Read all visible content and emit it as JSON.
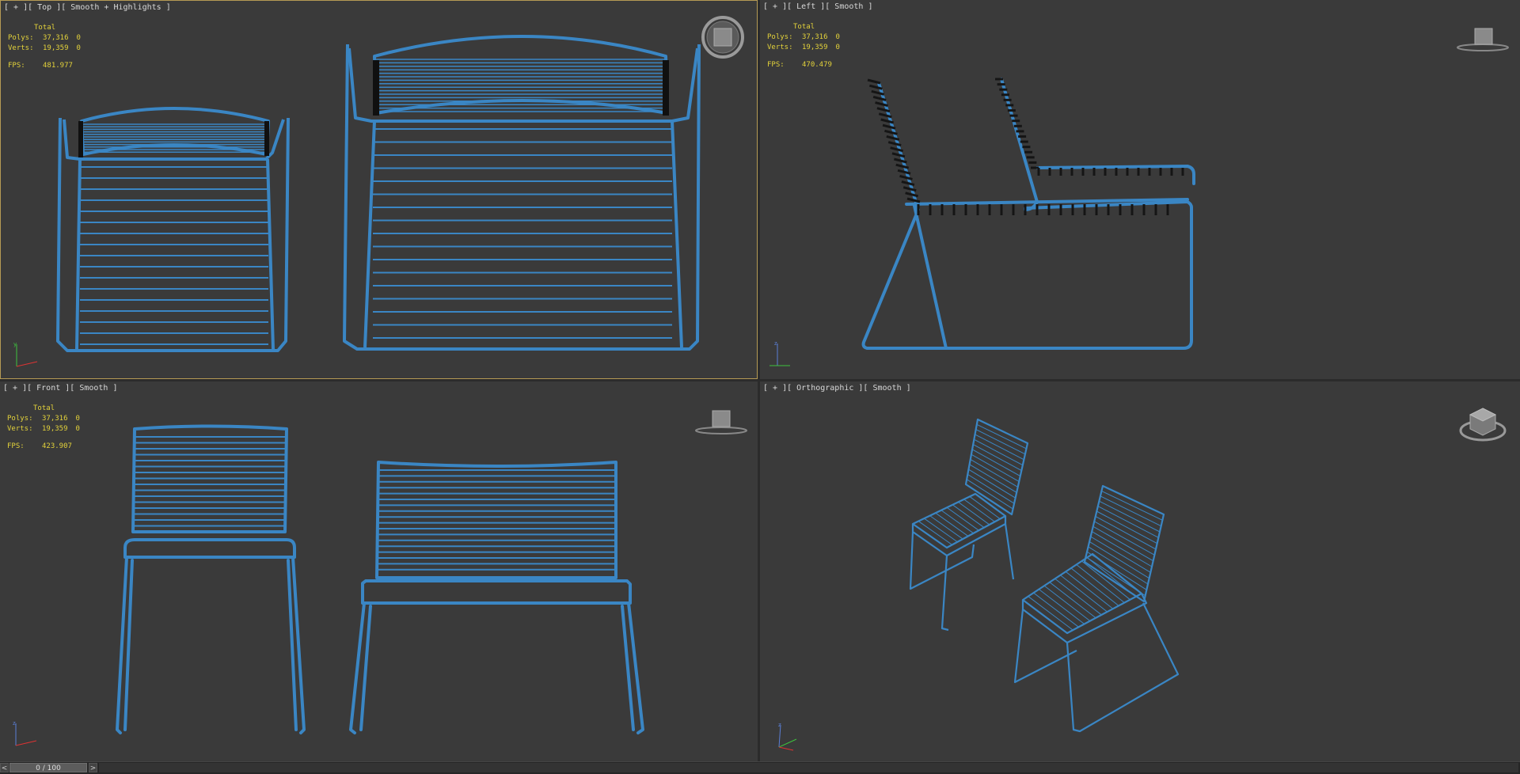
{
  "viewports": {
    "top": {
      "label": "[ + ][ Top ][ Smooth + Highlights ]",
      "stats": {
        "total": "Total",
        "polys_label": "Polys:",
        "polys": "37,316",
        "polys_sel": "0",
        "verts_label": "Verts:",
        "verts": "19,359",
        "verts_sel": "0",
        "fps_label": "FPS:",
        "fps": "481.977"
      },
      "viewcube_icon": "viewcube-top-icon"
    },
    "left": {
      "label": "[ + ][ Left ][ Smooth ]",
      "stats": {
        "total": "Total",
        "polys_label": "Polys:",
        "polys": "37,316",
        "polys_sel": "0",
        "verts_label": "Verts:",
        "verts": "19,359",
        "verts_sel": "0",
        "fps_label": "FPS:",
        "fps": "470.479"
      },
      "viewcube_icon": "viewcube-left-icon"
    },
    "front": {
      "label": "[ + ][ Front ][ Smooth ]",
      "stats": {
        "total": "Total",
        "polys_label": "Polys:",
        "polys": "37,316",
        "polys_sel": "0",
        "verts_label": "Verts:",
        "verts": "19,359",
        "verts_sel": "0",
        "fps_label": "FPS:",
        "fps": "423.907"
      },
      "viewcube_icon": "viewcube-front-icon"
    },
    "ortho": {
      "label": "[ + ][ Orthographic ][ Smooth ]",
      "viewcube_icon": "viewcube-perspective-icon"
    }
  },
  "timeline": {
    "prev": "<",
    "frame": "0 / 100",
    "next": ">"
  },
  "colors": {
    "wire": "#3a86c4",
    "background": "#3a3a3a",
    "stats": "#e3d23a",
    "active_border": "#b59a54"
  }
}
